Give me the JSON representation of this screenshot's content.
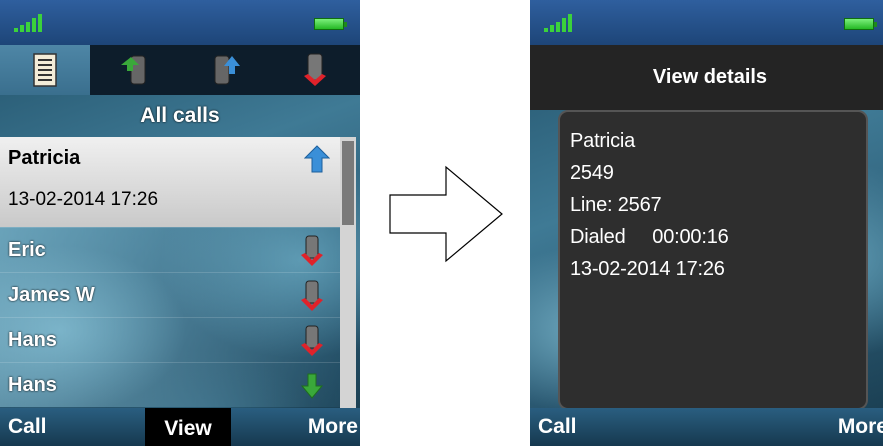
{
  "left_screen": {
    "tabs": [
      {
        "icon": "call-list-icon",
        "active": true
      },
      {
        "icon": "incoming-call-icon",
        "active": false
      },
      {
        "icon": "outgoing-call-icon",
        "active": false
      },
      {
        "icon": "missed-call-icon",
        "active": false
      }
    ],
    "list_title": "All calls",
    "selected_entry": {
      "name": "Patricia",
      "datetime": "13-02-2014 17:26",
      "icon": "outgoing-arrow-icon"
    },
    "entries": [
      {
        "name": "Eric",
        "icon": "missed-call-icon"
      },
      {
        "name": "James W",
        "icon": "missed-call-icon"
      },
      {
        "name": "Hans",
        "icon": "missed-call-icon"
      },
      {
        "name": "Hans",
        "icon": "incoming-arrow-icon"
      }
    ],
    "softkeys": {
      "left": "Call",
      "center": "View",
      "right": "More"
    }
  },
  "right_screen": {
    "title": "View details",
    "details": {
      "name": "Patricia",
      "number": "2549",
      "line": "Line: 2567",
      "dialed": "Dialed     00:00:16",
      "datetime": "13-02-2014 17:26"
    },
    "softkeys": {
      "left": "Call",
      "right": "More"
    }
  },
  "colors": {
    "signal": "#3bd23b",
    "battery": "#25b925",
    "incoming_arrow": "#3aa83a",
    "outgoing_arrow": "#3a8fd8",
    "missed_red": "#e0222a"
  }
}
